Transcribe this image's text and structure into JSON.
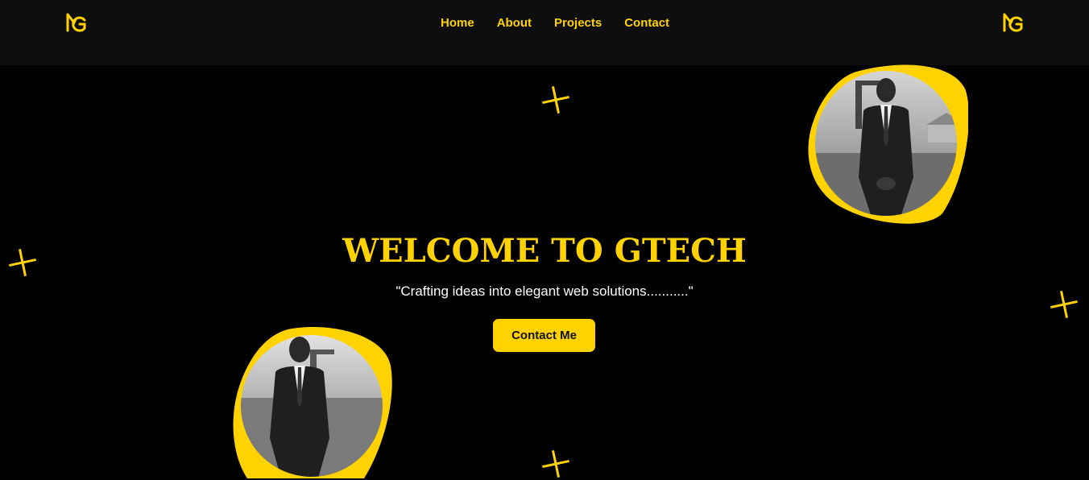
{
  "nav": {
    "logo_icon": "mg-monogram-logo",
    "links": [
      {
        "label": "Home"
      },
      {
        "label": "About"
      },
      {
        "label": "Projects"
      },
      {
        "label": "Contact"
      }
    ]
  },
  "hero": {
    "title": "WELCOME TO GTECH",
    "subtitle": "\"Crafting ideas into elegant web solutions...........\"",
    "cta_label": "Contact Me"
  },
  "decor": {
    "plus_icon": "sparkle-plus-icon",
    "accent_color": "#ffd200",
    "navbar_bg": "#0e0e0e",
    "page_bg": "#000000"
  },
  "images": {
    "top_right_photo": "portrait-photo",
    "bottom_left_photo": "portrait-photo"
  }
}
